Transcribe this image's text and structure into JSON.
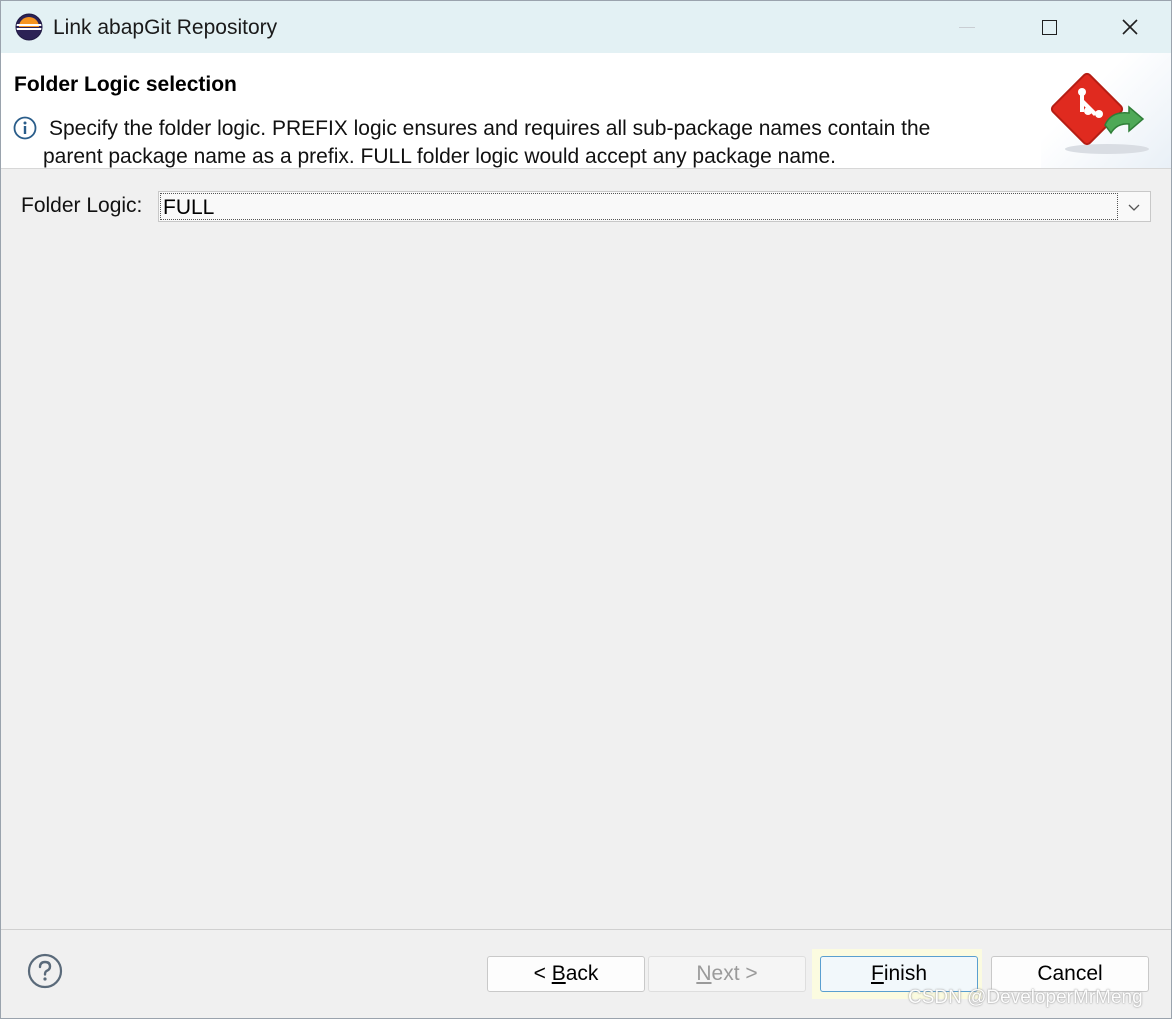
{
  "window": {
    "title": "Link abapGit Repository"
  },
  "header": {
    "title": "Folder Logic selection",
    "message_line1": "Specify the folder logic. PREFIX logic ensures and requires all sub-package names contain the",
    "message_line2": "parent package name as a prefix. FULL folder logic would accept any package name."
  },
  "form": {
    "folder_logic_label": "Folder Logic:",
    "folder_logic_value": "FULL"
  },
  "buttons": {
    "back_prefix": "< ",
    "back_mnemonic": "B",
    "back_rest": "ack",
    "next_mnemonic": "N",
    "next_rest": "ext >",
    "finish_mnemonic": "F",
    "finish_rest": "inish",
    "cancel": "Cancel"
  },
  "watermark": "CSDN @DeveloperMrMeng",
  "colors": {
    "titlebar_bg": "#e3f1f4",
    "body_bg": "#f0f0f0",
    "header_bg": "#ffffff",
    "finish_highlight": "#fbfbe0",
    "finish_border": "#5a9fd0"
  },
  "icons": {
    "app": "eclipse-icon",
    "info": "info-icon",
    "wizard": "abapgit-link-icon",
    "dropdown": "chevron-down-icon",
    "help": "help-icon"
  }
}
